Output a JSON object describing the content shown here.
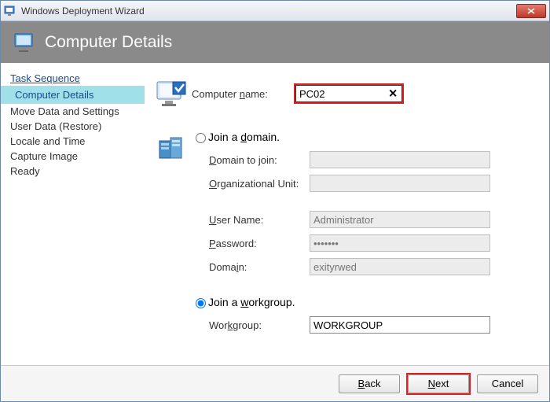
{
  "window": {
    "title": "Windows Deployment Wizard"
  },
  "banner": {
    "title": "Computer Details"
  },
  "sidebar": {
    "items": [
      {
        "label": "Task Sequence",
        "state": "completed"
      },
      {
        "label": "Computer Details",
        "state": "active"
      },
      {
        "label": "Move Data and Settings",
        "state": "pending"
      },
      {
        "label": "User Data (Restore)",
        "state": "pending"
      },
      {
        "label": "Locale and Time",
        "state": "pending"
      },
      {
        "label": "Capture Image",
        "state": "pending"
      },
      {
        "label": "Ready",
        "state": "pending"
      }
    ]
  },
  "form": {
    "computer_name_label": "Computer name:",
    "computer_name_value": "PC02",
    "join_domain_label": "Join a domain.",
    "domain_to_join_label": "Domain to join:",
    "domain_to_join_value": "",
    "org_unit_label": "Organizational Unit:",
    "org_unit_value": "",
    "username_label": "User Name:",
    "username_placeholder": "Administrator",
    "password_label": "Password:",
    "password_value": "•••••••",
    "domain_label": "Domain:",
    "domain_placeholder": "exityrwed",
    "join_workgroup_label": "Join a workgroup.",
    "workgroup_label": "Workgroup:",
    "workgroup_value": "WORKGROUP",
    "selected_option": "workgroup"
  },
  "footer": {
    "back_label": "Back",
    "next_label": "Next",
    "cancel_label": "Cancel"
  }
}
